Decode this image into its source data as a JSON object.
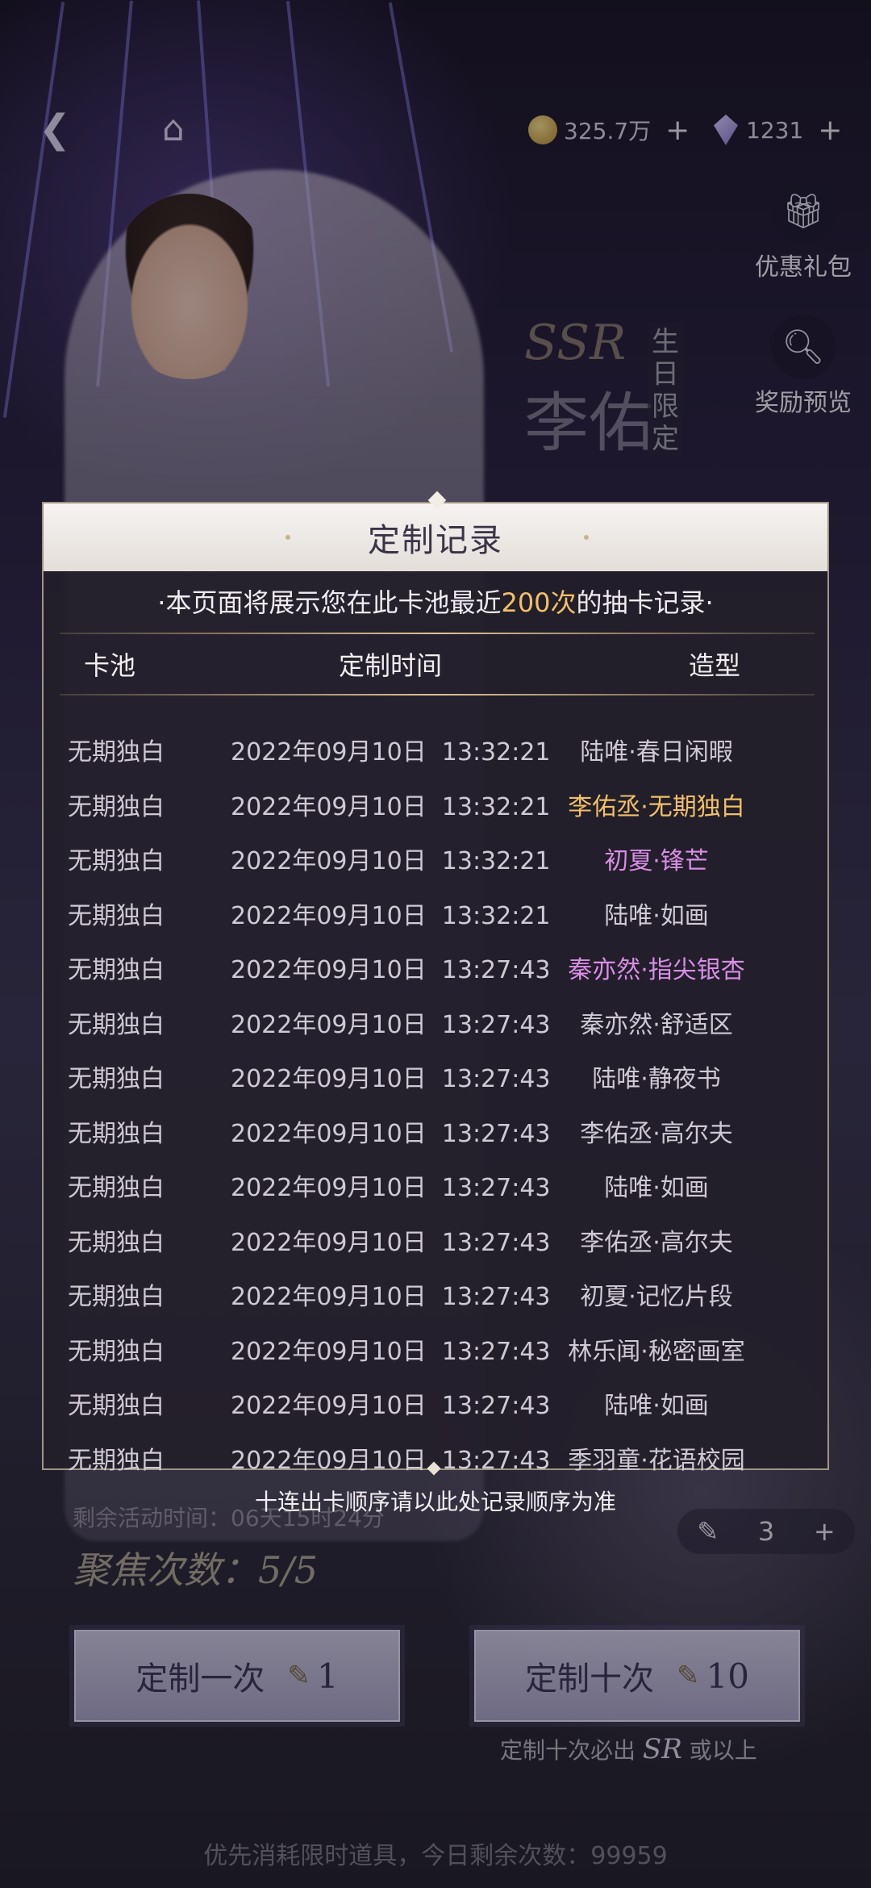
{
  "topbar": {
    "coins": "325.7万",
    "gems": "1231",
    "plus": "+"
  },
  "side_menu": [
    {
      "label": "优惠礼包",
      "icon": "gift-icon"
    },
    {
      "label": "奖励预览",
      "icon": "search-icon"
    }
  ],
  "banner": {
    "rarity": "SSR",
    "name_fragment": "李佑",
    "vertical": "生日限定"
  },
  "modal": {
    "title": "定制记录",
    "notice_prefix": "·本页面将展示您在此卡池最近",
    "notice_count": "200次",
    "notice_suffix": "的抽卡记录·",
    "columns": {
      "pool": "卡池",
      "time": "定制时间",
      "style": "造型"
    },
    "records": [
      {
        "pool": "无期独白",
        "time": "2022年09月10日  13:32:21",
        "style": "陆唯·春日闲暇",
        "color": "#cfc9d3"
      },
      {
        "pool": "无期独白",
        "time": "2022年09月10日  13:32:21",
        "style": "李佑丞·无期独白",
        "color": "#f1c067"
      },
      {
        "pool": "无期独白",
        "time": "2022年09月10日  13:32:21",
        "style": "初夏·锋芒",
        "color": "#d98ee6"
      },
      {
        "pool": "无期独白",
        "time": "2022年09月10日  13:32:21",
        "style": "陆唯·如画",
        "color": "#cfc9d3"
      },
      {
        "pool": "无期独白",
        "time": "2022年09月10日  13:27:43",
        "style": "秦亦然·指尖银杏",
        "color": "#d98ee6"
      },
      {
        "pool": "无期独白",
        "time": "2022年09月10日  13:27:43",
        "style": "秦亦然·舒适区",
        "color": "#cfc9d3"
      },
      {
        "pool": "无期独白",
        "time": "2022年09月10日  13:27:43",
        "style": "陆唯·静夜书",
        "color": "#cfc9d3"
      },
      {
        "pool": "无期独白",
        "time": "2022年09月10日  13:27:43",
        "style": "李佑丞·高尔夫",
        "color": "#cfc9d3"
      },
      {
        "pool": "无期独白",
        "time": "2022年09月10日  13:27:43",
        "style": "陆唯·如画",
        "color": "#cfc9d3"
      },
      {
        "pool": "无期独白",
        "time": "2022年09月10日  13:27:43",
        "style": "李佑丞·高尔夫",
        "color": "#cfc9d3"
      },
      {
        "pool": "无期独白",
        "time": "2022年09月10日  13:27:43",
        "style": "初夏·记忆片段",
        "color": "#cfc9d3"
      },
      {
        "pool": "无期独白",
        "time": "2022年09月10日  13:27:43",
        "style": "林乐闻·秘密画室",
        "color": "#cfc9d3"
      },
      {
        "pool": "无期独白",
        "time": "2022年09月10日  13:27:43",
        "style": "陆唯·如画",
        "color": "#cfc9d3"
      },
      {
        "pool": "无期独白",
        "time": "2022年09月10日  13:27:43",
        "style": "季羽童·花语校园",
        "color": "#cfc9d3"
      }
    ],
    "footer_note": "十连出卡顺序请以此处记录顺序为准"
  },
  "event": {
    "remaining_time": "剩余活动时间：06天15时24分",
    "focus_count": "聚焦次数：5/5",
    "item_count": "3"
  },
  "buttons": {
    "single_label": "定制一次",
    "single_cost": "1",
    "ten_label": "定制十次",
    "ten_cost": "10"
  },
  "guarantee": {
    "prefix": "定制十次必出",
    "tier": "SR",
    "suffix": "或以上"
  },
  "priority_note": "优先消耗限时道具，今日剩余次数：99959"
}
